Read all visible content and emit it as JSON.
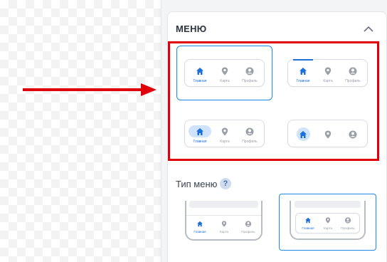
{
  "panel": {
    "section_title": "МЕНЮ",
    "type_label": "Тип меню",
    "help_mark": "?"
  },
  "nav": {
    "home": "Главная",
    "map": "Карта",
    "profile": "Профиль"
  },
  "colors": {
    "accent": "#1e6fd9",
    "highlight_border": "#e0000c",
    "arrow": "#e0000c",
    "pill": "#cfe3fb"
  },
  "icons": [
    "home-icon",
    "map-pin-icon",
    "user-circle-icon",
    "chevron-up-icon"
  ],
  "menu_styles": [
    {
      "id": "plain",
      "selected": true
    },
    {
      "id": "top-indicator",
      "selected": false
    },
    {
      "id": "pill",
      "selected": false
    },
    {
      "id": "circle-icons-only",
      "selected": false
    }
  ],
  "menu_types": [
    {
      "id": "attached",
      "selected": false
    },
    {
      "id": "floating",
      "selected": true
    }
  ]
}
